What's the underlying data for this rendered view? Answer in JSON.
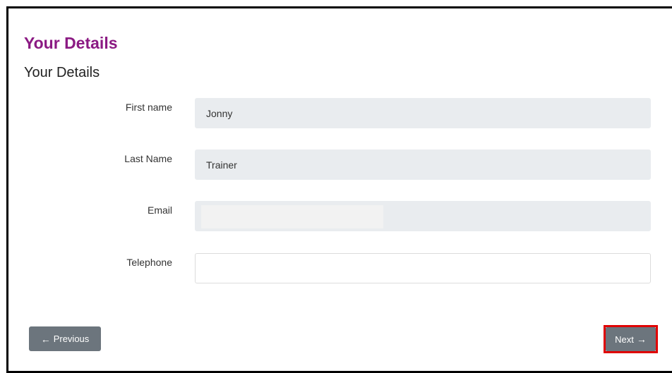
{
  "header": {
    "page_title": "Your Details",
    "section_title": "Your Details"
  },
  "form": {
    "fields": [
      {
        "label": "First name",
        "value": "Jonny"
      },
      {
        "label": "Last Name",
        "value": "Trainer"
      },
      {
        "label": "Email",
        "value": ""
      },
      {
        "label": "Telephone",
        "value": ""
      }
    ]
  },
  "footer": {
    "previous_label": "Previous",
    "previous_icon": "arrow-left-icon",
    "next_label": "Next",
    "next_icon": "arrow-right-icon"
  },
  "colors": {
    "title": "#8b1a83",
    "button": "#6c757d",
    "readonly_field": "#e9ecef",
    "highlight_border": "#e00000"
  }
}
